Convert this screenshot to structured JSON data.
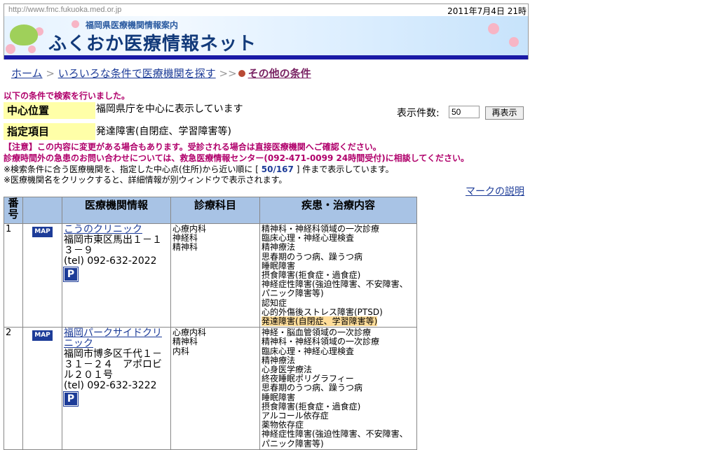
{
  "topbar": {
    "url": "http://www.fmc.fukuoka.med.or.jp",
    "date": "2011年7月4日 21時"
  },
  "banner": {
    "subtitle": "福岡県医療機関情報案内",
    "title": "ふくおか医療情報ネット"
  },
  "breadcrumb": {
    "home": "ホーム",
    "sep1": ">",
    "search": "いろいろな条件で医療機関を探す",
    "sep2": ">>",
    "current": "その他の条件"
  },
  "search_done": "以下の条件で検索を行いました。",
  "conditions": [
    {
      "label": "中心位置",
      "value": "福岡県庁を中心に表示しています"
    },
    {
      "label": "指定項目",
      "value": "発達障害(自閉症、学習障害等)"
    }
  ],
  "display_count": {
    "label": "表示件数:",
    "value": "50",
    "button": "再表示"
  },
  "notices": {
    "line1": "【注意】この内容に変更がある場合もあります。受診される場合は直接医療機関へご確認ください。",
    "line2": "診療時間外の急患のお問い合わせについては、救急医療情報センター(092-471-0099 24時間受付)に相談してください。",
    "line3_pre": "※検索条件に合う医療機関を、指定した中心点(住所)から近い順に [",
    "line3_count": "50/167",
    "line3_post": "] 件まで表示しています。",
    "line4": "※医療機関名をクリックすると、詳細情報が別ウィンドウで表示されます。"
  },
  "mark_link": "マークの説明",
  "table": {
    "headers": [
      "番号",
      "",
      "医療機関情報",
      "診療科目",
      "疾患・治療内容"
    ],
    "map_label": "MAP",
    "parking_label": "P",
    "rows": [
      {
        "num": "1",
        "name": "こうのクリニック",
        "address": "福岡市東区馬出１－１３－９",
        "tel": "(tel) 092-632-2022",
        "departments": [
          "心療内科",
          "神経科",
          "精神科"
        ],
        "treatments": [
          "精神科・神経科領域の一次診療",
          "臨床心理・神経心理検査",
          "精神療法",
          "思春期のうつ病、躁うつ病",
          "睡眠障害",
          "摂食障害(拒食症・過食症)",
          "神経症性障害(強迫性障害、不安障害、パニック障害等)",
          "認知症",
          "心的外傷後ストレス障害(PTSD)"
        ],
        "highlight": "発達障害(自閉症、学習障害等)"
      },
      {
        "num": "2",
        "name": "福岡パークサイドクリニック",
        "address": "福岡市博多区千代１－３１－２４　アポロビル２０１号",
        "tel": "(tel) 092-632-3222",
        "departments": [
          "心療内科",
          "精神科",
          "内科"
        ],
        "treatments": [
          "神経・脳血管領域の一次診療",
          "精神科・神経科領域の一次診療",
          "臨床心理・神経心理検査",
          "精神療法",
          "心身医学療法",
          "終夜睡眠ポリグラフィー",
          "思春期のうつ病、躁うつ病",
          "睡眠障害",
          "摂食障害(拒食症・過食症)",
          "アルコール依存症",
          "薬物依存症",
          "神経症性障害(強迫性障害、不安障害、パニック障害等)"
        ]
      }
    ]
  }
}
